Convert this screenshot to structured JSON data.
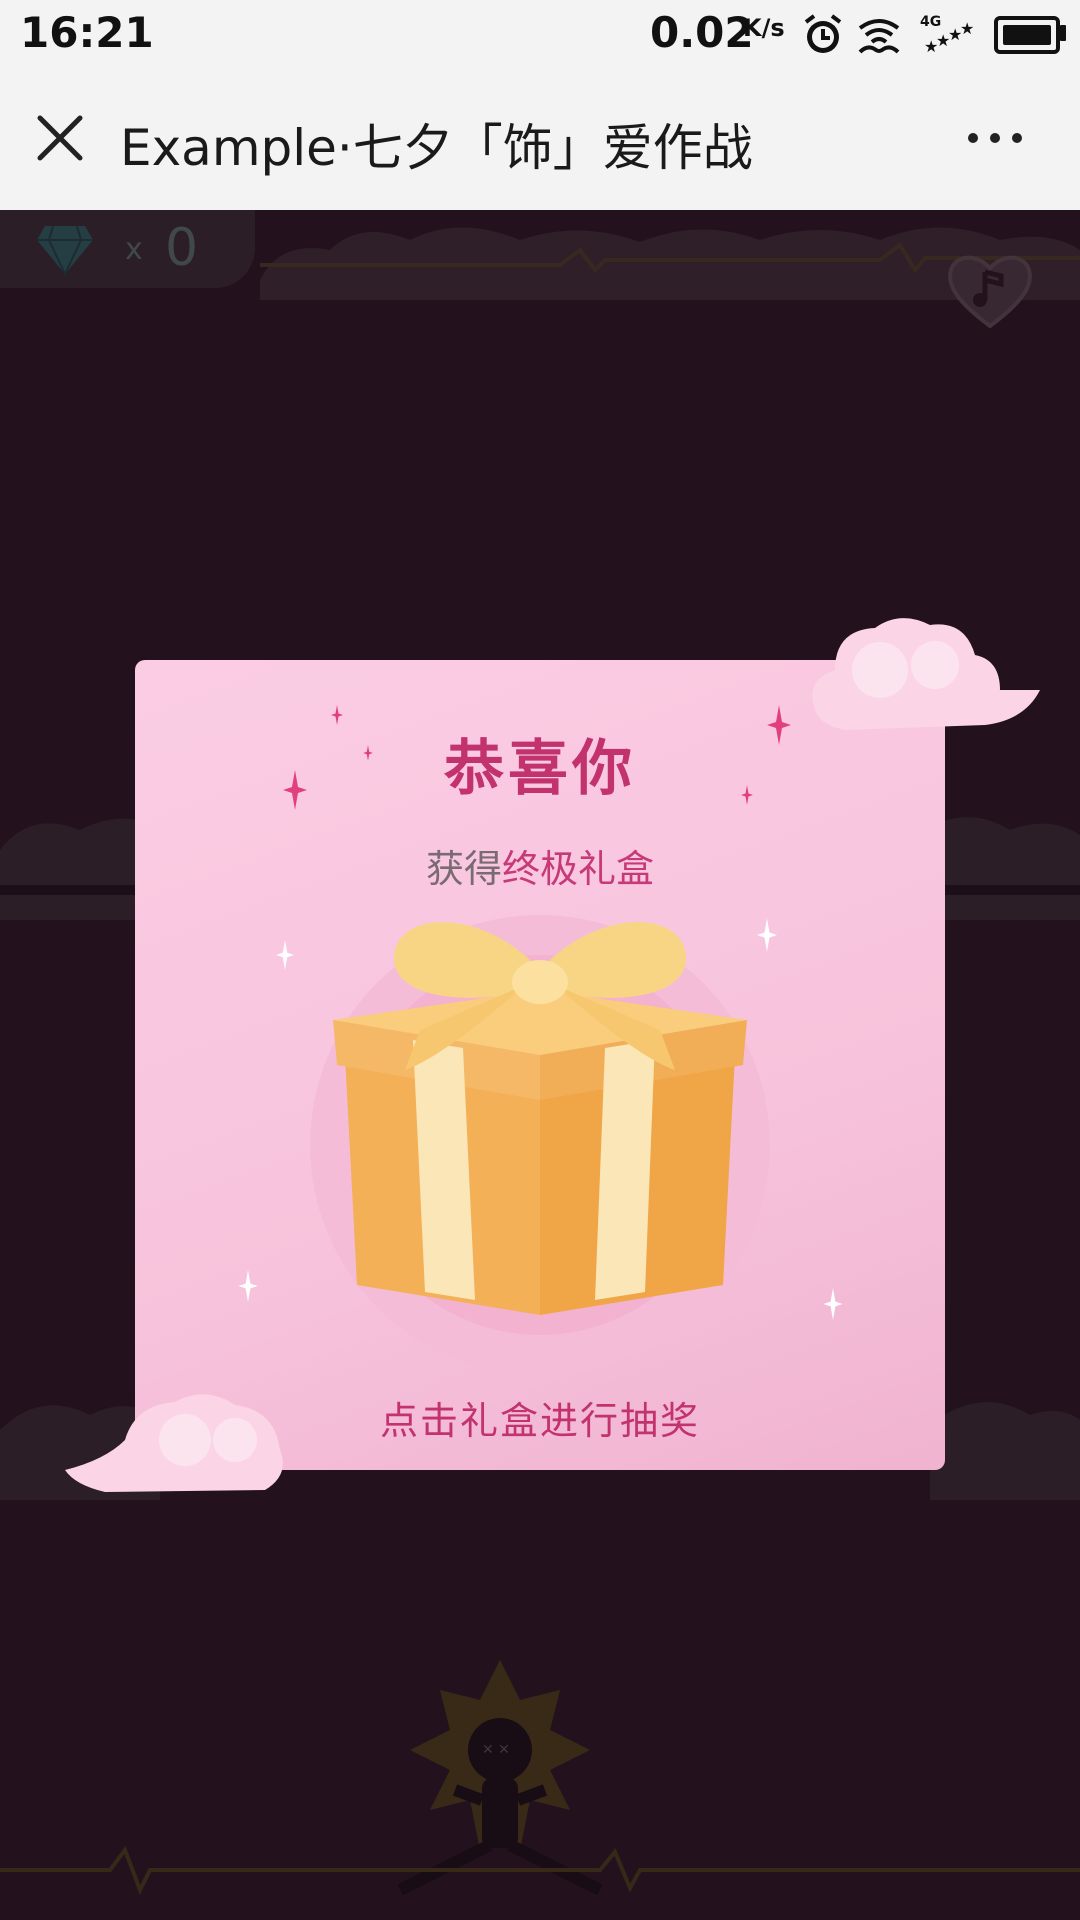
{
  "status_bar": {
    "time": "16:21",
    "speed": "0.02",
    "speed_unit": "K/s",
    "network": "4G"
  },
  "nav": {
    "title": "Example·七夕「饰」爱作战",
    "close_icon": "close-icon",
    "more_icon": "more-icon"
  },
  "game": {
    "gem_multiplier": "x",
    "gem_count": "0",
    "gem_icon": "diamond-icon",
    "music_icon": "music-heart-icon"
  },
  "modal": {
    "title": "恭喜你",
    "subtitle_prefix": "获得",
    "subtitle_highlight": "终极礼盒",
    "cta": "点击礼盒进行抽奖",
    "gift_icon": "gift-box-icon"
  },
  "colors": {
    "accent": "#c2336e",
    "modal_bg": "#f8c6df",
    "game_bg": "#2b1726"
  }
}
